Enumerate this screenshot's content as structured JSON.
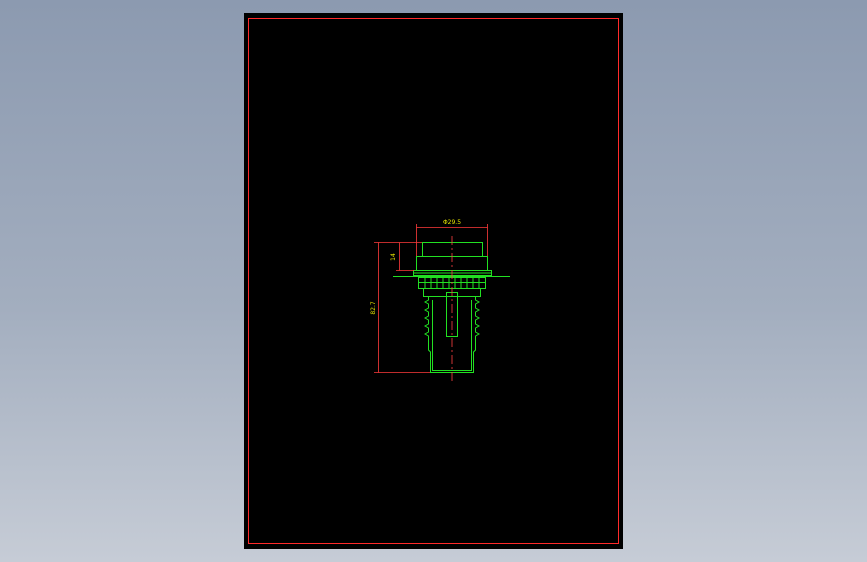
{
  "drawing": {
    "dimensions": {
      "diameter": "Φ29.5",
      "top_height": "14",
      "overall_height": "82.7"
    },
    "colors": {
      "viewport_background": "#9aa6b8",
      "sheet_background": "#000000",
      "border": "#ff2a2a",
      "part_outline": "#22e022",
      "dimension_line": "#ff3b3b",
      "dimension_text": "#e6e600",
      "centerline": "#ff4040"
    }
  }
}
